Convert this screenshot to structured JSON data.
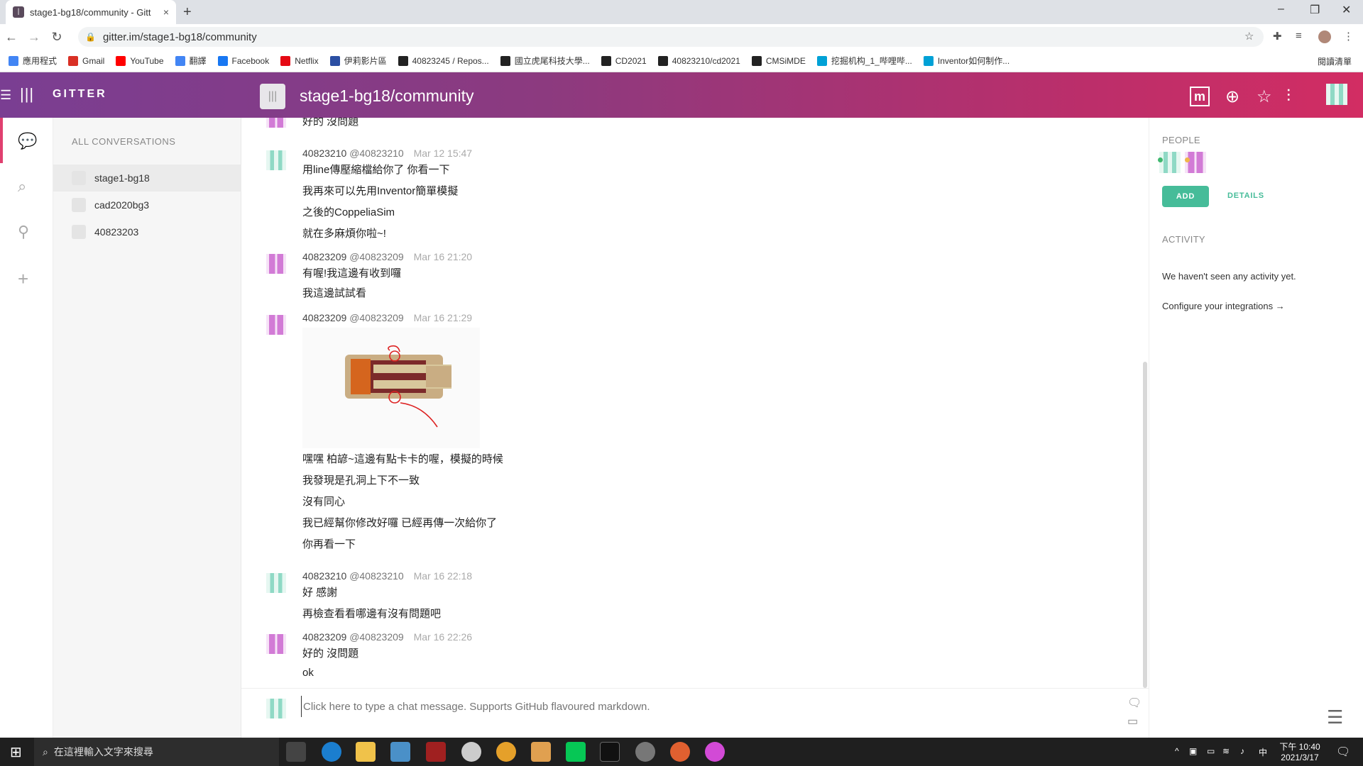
{
  "browser": {
    "tab_title": "stage1-bg18/community - Gitt",
    "tab_close": "×",
    "new_tab": "+",
    "url": "gitter.im/stage1-bg18/community",
    "win_min": "–",
    "win_max": "❐",
    "win_close": "✕",
    "bookmarks": [
      {
        "label": "應用程式",
        "color": "#4285f4"
      },
      {
        "label": "Gmail",
        "color": "#d93025"
      },
      {
        "label": "YouTube",
        "color": "#ff0000"
      },
      {
        "label": "翻譯",
        "color": "#4285f4"
      },
      {
        "label": "Facebook",
        "color": "#1877f2"
      },
      {
        "label": "Netflix",
        "color": "#e50914"
      },
      {
        "label": "伊莉影片區",
        "color": "#2b4fa3"
      },
      {
        "label": "40823245 / Repos...",
        "color": "#222222"
      },
      {
        "label": "國立虎尾科技大學...",
        "color": "#222222"
      },
      {
        "label": "CD2021",
        "color": "#222222"
      },
      {
        "label": "40823210/cd2021",
        "color": "#222222"
      },
      {
        "label": "CMSiMDE",
        "color": "#222222"
      },
      {
        "label": "挖掘机构_1_哔哩哔...",
        "color": "#00a1d6"
      },
      {
        "label": "Inventor如何制作...",
        "color": "#00a1d6"
      }
    ],
    "reading_list": "閱讀清單"
  },
  "header": {
    "logo_text": "GITTER",
    "room_title": "stage1-bg18/community",
    "matrix_label": "m"
  },
  "conversations": {
    "header": "ALL CONVERSATIONS",
    "items": [
      {
        "label": "stage1-bg18"
      },
      {
        "label": "cad2020bg3"
      },
      {
        "label": "40823203"
      }
    ]
  },
  "messages": {
    "m0": {
      "lines": [
        "好的 沒問題"
      ]
    },
    "m1": {
      "user": "40823210",
      "handle": "@40823210",
      "time": "Mar 12 15:47",
      "lines": [
        "用line傳壓縮檔給你了 你看一下",
        "我再來可以先用Inventor簡單模擬",
        "之後的CoppeliaSim",
        "就在多麻煩你啦~!"
      ]
    },
    "m2": {
      "user": "40823209",
      "handle": "@40823209",
      "time": "Mar 16 21:20",
      "lines": [
        "有喔!我這邊有收到囉",
        "我這邊試試看"
      ]
    },
    "m3": {
      "user": "40823209",
      "handle": "@40823209",
      "time": "Mar 16 21:29",
      "lines": [
        "嘿嘿 柏諺~這邊有點卡卡的喔，模擬的時候",
        "我發現是孔洞上下不一致",
        "沒有同心",
        "我已經幫你修改好囉 已經再傳一次給你了",
        "你再看一下"
      ]
    },
    "m4": {
      "user": "40823210",
      "handle": "@40823210",
      "time": "Mar 16 22:18",
      "lines": [
        "好 感謝",
        "再檢查看看哪邊有沒有問題吧"
      ]
    },
    "m5": {
      "user": "40823209",
      "handle": "@40823209",
      "time": "Mar 16 22:26",
      "lines": [
        "好的 沒問題",
        "ok"
      ]
    }
  },
  "input": {
    "placeholder": "Click here to type a chat message. Supports GitHub flavoured markdown."
  },
  "right_panel": {
    "people_header": "PEOPLE",
    "add_label": "ADD",
    "details_label": "DETAILS",
    "activity_header": "ACTIVITY",
    "activity_empty": "We haven't seen any activity yet.",
    "integrations_link": "Configure your integrations →"
  },
  "taskbar": {
    "search_placeholder": "在這裡輸入文字來搜尋",
    "time": "下午 10:40",
    "date": "2021/3/17",
    "ime": "中"
  },
  "colors": {
    "header_start": "#7a3e92",
    "header_end": "#d22d63",
    "accent_green": "#46bc99",
    "active_bar": "#e03f6f"
  }
}
